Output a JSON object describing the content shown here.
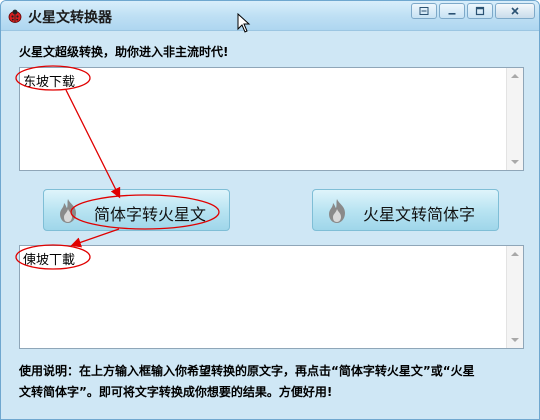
{
  "window": {
    "title": "火星文转换器"
  },
  "header": {
    "text": "火星文超级转换，助你进入非主流时代!"
  },
  "input_box": {
    "value": "东坡下载"
  },
  "buttons": {
    "to_mars": "简体字转火星文",
    "to_simplified": "火星文转简体字"
  },
  "output_box": {
    "value": "倲坡丅載"
  },
  "usage": {
    "line1": "使用说明：在上方输入框输入你希望转换的原文字，再点击“简体字转火星文”或“火星",
    "line2": "文转简体字”。即可将文字转换成你想要的结果。方便好用!"
  },
  "icons": {
    "app": "ladybug-icon",
    "cursor": "mouse-cursor-icon",
    "flame": "flame-icon"
  },
  "colors": {
    "window_bg": "#cfe7f5",
    "titlebar": "#bfe0f4",
    "button_bg": "#b9e4f2",
    "annotation": "#e00000"
  }
}
